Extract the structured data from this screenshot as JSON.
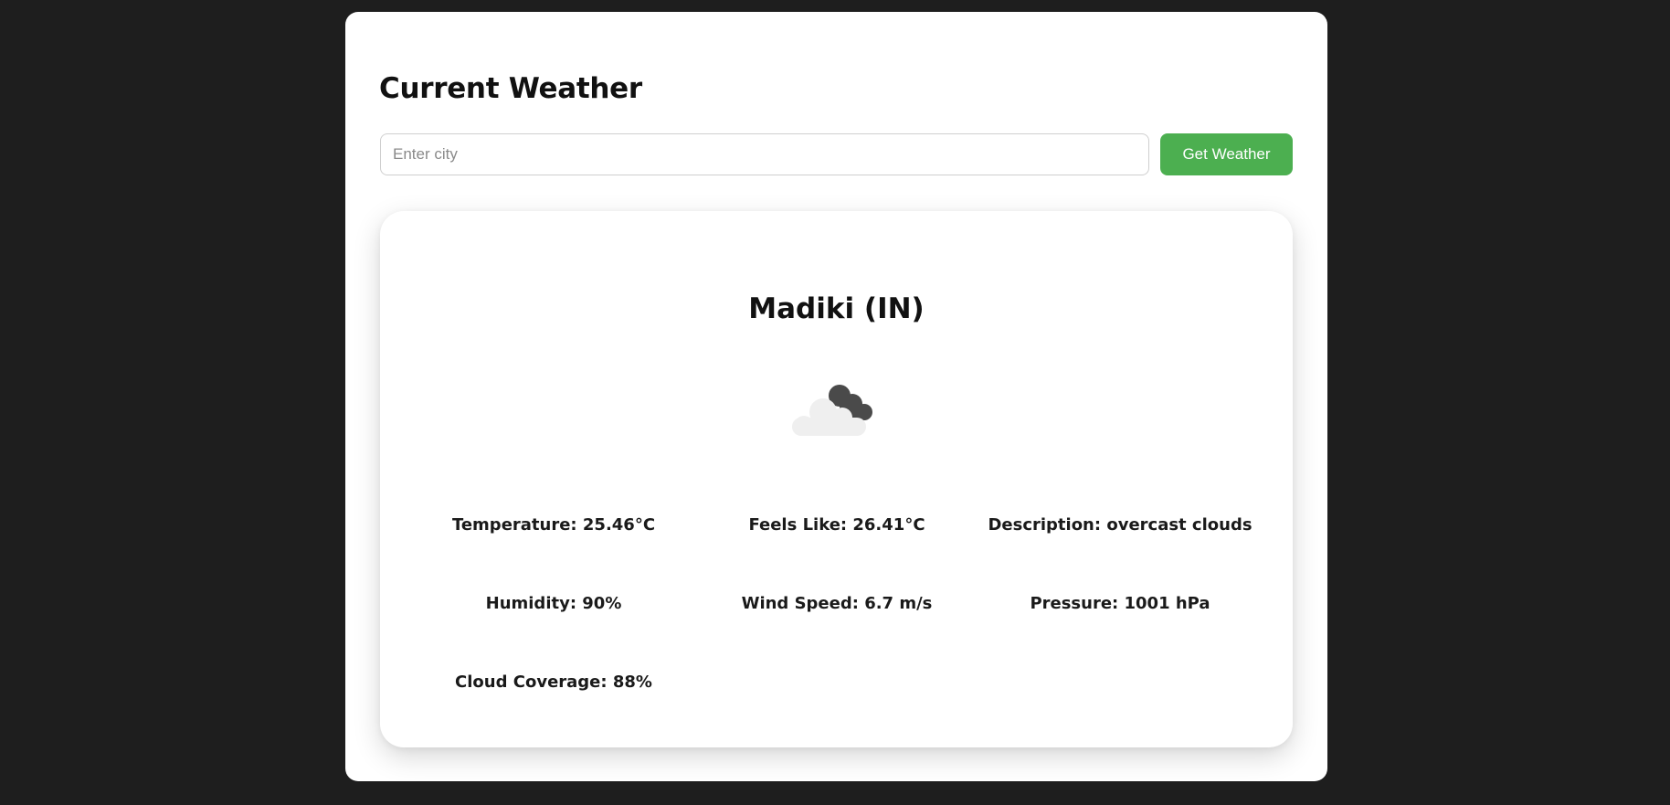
{
  "header": {
    "title": "Current Weather"
  },
  "search": {
    "placeholder": "Enter city",
    "value": "",
    "button_label": "Get Weather"
  },
  "result": {
    "city": "Madiki (IN)",
    "icon": "overcast-clouds-icon",
    "details": {
      "temperature": "Temperature: 25.46°C",
      "feels_like": "Feels Like: 26.41°C",
      "description": "Description: overcast clouds",
      "humidity": "Humidity: 90%",
      "wind_speed": "Wind Speed: 6.7 m/s",
      "pressure": "Pressure: 1001 hPa",
      "cloud_coverage": "Cloud Coverage: 88%"
    }
  },
  "colors": {
    "page_background": "#1e1e1e",
    "panel_background": "#ffffff",
    "button_background": "#4caf50",
    "button_text": "#ffffff",
    "cloud_light": "#f0f0f0",
    "cloud_dark": "#4a4a4a"
  }
}
